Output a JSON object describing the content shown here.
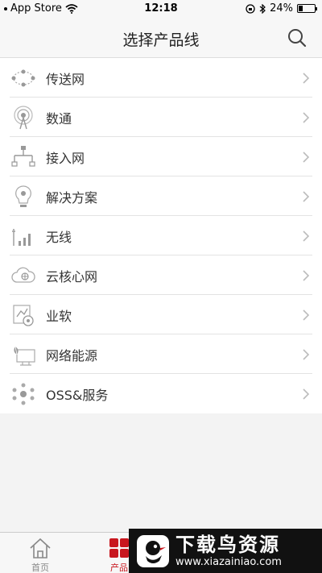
{
  "status_bar": {
    "carrier": "App Store",
    "time": "12:18",
    "battery_percent": "24%",
    "battery_level": 0.24
  },
  "nav": {
    "title": "选择产品线",
    "search_icon": "search-icon"
  },
  "product_lines": [
    {
      "label": "传送网",
      "icon": "transport-network-icon"
    },
    {
      "label": "数通",
      "icon": "datacom-icon"
    },
    {
      "label": "接入网",
      "icon": "access-network-icon"
    },
    {
      "label": "解决方案",
      "icon": "solution-icon"
    },
    {
      "label": "无线",
      "icon": "wireless-icon"
    },
    {
      "label": "云核心网",
      "icon": "cloud-core-icon"
    },
    {
      "label": "业软",
      "icon": "business-software-icon"
    },
    {
      "label": "网络能源",
      "icon": "network-energy-icon"
    },
    {
      "label": "OSS&服务",
      "icon": "oss-service-icon"
    }
  ],
  "tab_bar": {
    "home_label": "首页",
    "products_label": "产品",
    "active_color": "#c8161e"
  },
  "watermark": {
    "title": "下载鸟资源",
    "url": "www.xiazainiao.com"
  }
}
